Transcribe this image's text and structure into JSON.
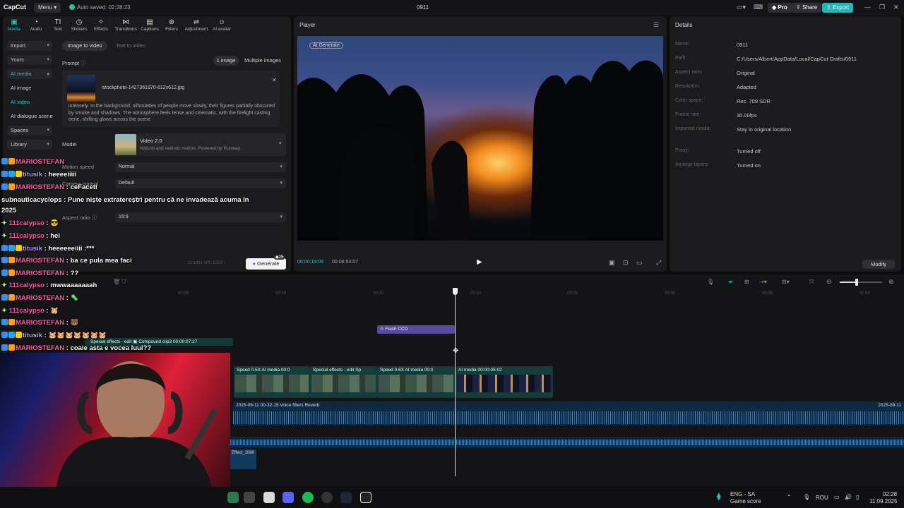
{
  "topbar": {
    "app_name": "CapCut",
    "menu_label": "Menu",
    "autosave_text": "Auto saved: 02:28:23",
    "project_title": "0911",
    "pro_label": "Pro",
    "share_label": "Share",
    "export_label": "Export"
  },
  "toolbar": {
    "items": [
      {
        "label": "Media",
        "icon": "media-icon"
      },
      {
        "label": "Audio",
        "icon": "audio-icon"
      },
      {
        "label": "Text",
        "icon": "text-icon"
      },
      {
        "label": "Stickers",
        "icon": "stickers-icon"
      },
      {
        "label": "Effects",
        "icon": "effects-icon"
      },
      {
        "label": "Transitions",
        "icon": "transitions-icon"
      },
      {
        "label": "Captions",
        "icon": "captions-icon"
      },
      {
        "label": "Filters",
        "icon": "filters-icon"
      },
      {
        "label": "Adjustment",
        "icon": "adjustment-icon"
      },
      {
        "label": "AI avatar",
        "icon": "ai-avatar-icon"
      }
    ]
  },
  "sidebar": {
    "items": [
      {
        "label": "Import"
      },
      {
        "label": "Yours"
      },
      {
        "label": "AI media"
      },
      {
        "label": "AI image"
      },
      {
        "label": "AI video"
      },
      {
        "label": "AI dialogue scene"
      },
      {
        "label": "Spaces"
      },
      {
        "label": "Library"
      }
    ]
  },
  "ai_panel": {
    "tab_image_to_video": "Image to video",
    "tab_text_to_video": "Text to video",
    "prompt_label": "Prompt",
    "single_image": "1 image",
    "multiple_images": "Multiple images",
    "file_name": "istockphoto-1427361970-612x612.jpg",
    "prompt_text": "intensely. In the background, silhouettes of people move slowly, their figures partially obscured by smoke and shadows. The atmosphere feels tense and cinematic, with the firelight casting eerie, shifting glows across the scene",
    "model_label": "Model",
    "model_name": "Video 2.0",
    "model_desc": "Natural and realistic motion. Powered by Runway.",
    "motion_speed_label": "Motion speed",
    "motion_speed_value": "Normal",
    "camera_control_label": "Camera control",
    "camera_control_value": "Default",
    "aspect_ratio_label": "Aspect ratio",
    "aspect_ratio_value": "16:9",
    "credits_text": "Credits left: 1050",
    "generate_label": "Generate",
    "generate_cost": "25"
  },
  "player": {
    "title": "Player",
    "badge": "AI Generate",
    "current_time": "00:00:19:09",
    "total_time": "00:06:54:07"
  },
  "details": {
    "title": "Details",
    "rows": [
      {
        "label": "Name:",
        "value": "0911"
      },
      {
        "label": "Path:",
        "value": "C:/Users/Albert/AppData/Local/CapCut Drafts/0911"
      },
      {
        "label": "Aspect ratio:",
        "value": "Original"
      },
      {
        "label": "Resolution:",
        "value": "Adapted"
      },
      {
        "label": "Color space:",
        "value": "Rec. 709 SDR"
      },
      {
        "label": "Frame rate:",
        "value": "30.00fps"
      },
      {
        "label": "Imported media:",
        "value": "Stay in original location"
      },
      {
        "label": "Proxy:",
        "value": "Turned off"
      },
      {
        "label": "Arrange layers:",
        "value": "Turned on"
      }
    ],
    "modify_label": "Modify"
  },
  "timeline": {
    "ticks": [
      "00:05",
      "00:10",
      "00:15",
      "00:20",
      "00:25",
      "00:30",
      "00:35",
      "00:40"
    ],
    "flash_clip": "Flash CCD",
    "compound_clip": "Compound clip3  00:00:07:27",
    "special_effects_top": "Special effects - edit",
    "clips": [
      "Speed 0.5X  AI media  00:0",
      "Special effects - edit  Sp",
      "Speed 0.6X  AI media  00:0",
      "AI media  00:00:05:02"
    ],
    "audio_label": "2025-09-11 00-32-15  Voice filters Reverb",
    "audio_label_end": "2025-09-11",
    "effect_clip": "Effect_1080"
  },
  "chat": [
    {
      "user": "MARIOSTEFAN",
      "msg": "",
      "color": "pink"
    },
    {
      "user": "titusik",
      "msg": "heeeeiiiii",
      "color": "purple"
    },
    {
      "user": "MARIOSTEFAN",
      "msg": "ceFaceti",
      "color": "pink"
    },
    {
      "user": "subnauticacyclops",
      "msg": "Pune niște extratereștri pentru că ne invadează acuma în",
      "color": "white"
    },
    {
      "user": "",
      "msg": "2025",
      "color": "white"
    },
    {
      "user": "111calypso",
      "msg": "",
      "color": "green"
    },
    {
      "user": "111calypso",
      "msg": "hei",
      "color": "green"
    },
    {
      "user": "titusik",
      "msg": "heeeeeeiiii :***",
      "color": "purple"
    },
    {
      "user": "MARIOSTEFAN",
      "msg": "ba ce pula mea faci",
      "color": "pink"
    },
    {
      "user": "MARIOSTEFAN",
      "msg": "??",
      "color": "pink"
    },
    {
      "user": "111calypso",
      "msg": "mwwaaaaaaah",
      "color": "green"
    },
    {
      "user": "MARIOSTEFAN",
      "msg": "",
      "color": "pink"
    },
    {
      "user": "111calypso",
      "msg": "",
      "color": "green"
    },
    {
      "user": "MARIOSTEFAN",
      "msg": "",
      "color": "pink"
    },
    {
      "user": "titusik",
      "msg": "",
      "color": "purple"
    },
    {
      "user": "MARIOSTEFAN",
      "msg": "coaie asta e vocea luui??",
      "color": "pink"
    }
  ],
  "taskbar": {
    "lang": "ENG - SA",
    "game_score": "Game score",
    "kbd": "ROU",
    "time": "02:28",
    "date": "11.09.2025"
  },
  "colors": {
    "accent": "#1fc7c7",
    "export": "#1fb7b7",
    "clip_bg": "#143c3b",
    "audio_bg": "#0d2a44"
  }
}
